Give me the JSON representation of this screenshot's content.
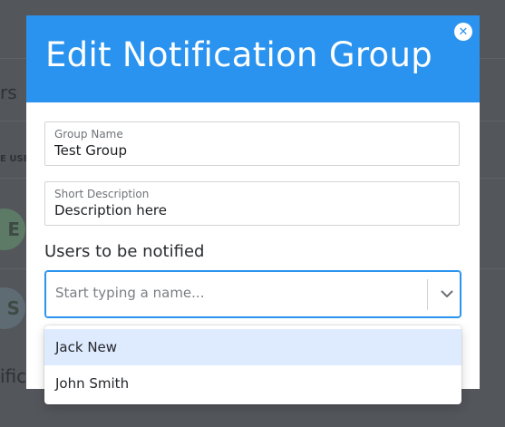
{
  "background": {
    "fragment_1": "rs",
    "fragment_2": "E USE",
    "avatar_1": "E",
    "avatar_2": "S",
    "fragment_3": "ifica"
  },
  "modal": {
    "title": "Edit Notification Group",
    "close_icon": "close-icon",
    "group_name": {
      "label": "Group Name",
      "value": "Test Group"
    },
    "short_description": {
      "label": "Short Description",
      "value": "Description here"
    },
    "users_heading": "Users to be notified",
    "users_select": {
      "placeholder": "Start typing a name...",
      "icon": "chevron-down-icon"
    },
    "options": [
      "Jack New",
      "John Smith"
    ]
  },
  "colors": {
    "accent": "#2a93ef",
    "focused_option": "#deebff",
    "overlay": "#53565b"
  }
}
